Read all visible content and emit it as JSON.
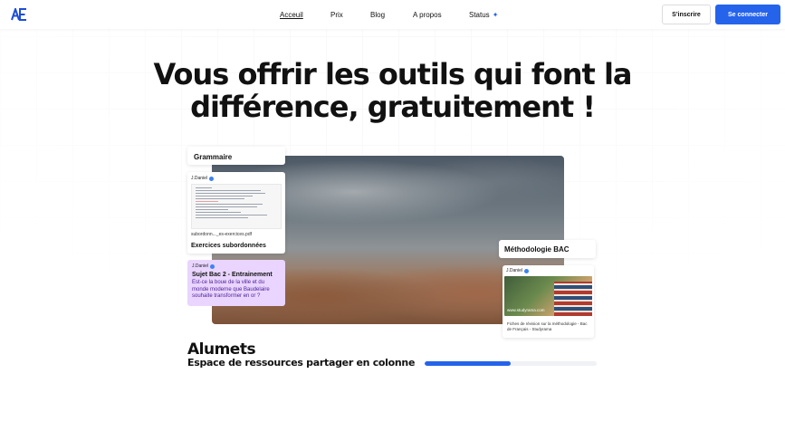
{
  "nav": {
    "links": [
      {
        "label": "Acceuil",
        "active": true
      },
      {
        "label": "Prix",
        "active": false
      },
      {
        "label": "Blog",
        "active": false
      },
      {
        "label": "A propos",
        "active": false
      },
      {
        "label": "Status",
        "active": false
      }
    ],
    "signup_label": "S'inscrire",
    "login_label": "Se connecter"
  },
  "hero": {
    "line1": "Vous offrir les outils qui font la",
    "line2": "différence, gratuitement !"
  },
  "cards": {
    "grammaire": {
      "title": "Grammaire",
      "author": "J.Daniel",
      "filename": "subordonn..._es-exercices.pdf",
      "caption": "Exercices subordonnées"
    },
    "sujet": {
      "author": "J.Daniel",
      "title": "Sujet Bac 2 - Entrainement",
      "body": "Est-ce la boue de la ville et du monde moderne que Baudelaire souhaite transformer en or ?"
    },
    "methodologie": {
      "title": "Méthodologie BAC",
      "author": "J.Daniel",
      "watermark": "www.studyrama.com",
      "description": "Fiches de révision sur la méthodologie - Bac de Français - Studyrama"
    }
  },
  "section": {
    "title": "Alumets",
    "subtitle": "Espace de ressources partager en colonne",
    "progress": 0.5
  },
  "colors": {
    "accent": "#2563eb",
    "sujet_bg": "#e9d5ff"
  }
}
